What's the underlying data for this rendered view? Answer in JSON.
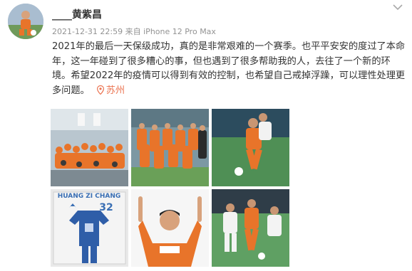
{
  "post": {
    "username": "____黄紫昌",
    "timestamp": "2021-12-31 22:59",
    "source_prefix": "来自",
    "device": "iPhone 12 Pro Max",
    "text": "2021年的最后一天保级成功，真的是非常艰难的一个赛季。也平平安安的度过了本命年，这一年碰到了很多糟心的事，但也遇到了很多帮助我的人，去往了一个新的环境。希望2022年的疫情可以得到有效的控制，也希望自己戒掉浮躁，可以理性处理更多问题。",
    "location": "苏州"
  },
  "photos": [
    {
      "name": "team-group-photo"
    },
    {
      "name": "team-lineup-photo"
    },
    {
      "name": "match-action-photo"
    },
    {
      "name": "jersey-frame-photo",
      "jersey_text": "HUANG ZI CHANG",
      "jersey_number": "32"
    },
    {
      "name": "player-portrait-photo"
    },
    {
      "name": "match-dribble-photo"
    }
  ],
  "colors": {
    "accent_orange": "#eb7350",
    "meta_gray": "#939393",
    "text": "#333333",
    "kit_orange": "#e8742a"
  },
  "icons": {
    "menu": "chevron-down-icon",
    "location": "location-pin-icon"
  }
}
